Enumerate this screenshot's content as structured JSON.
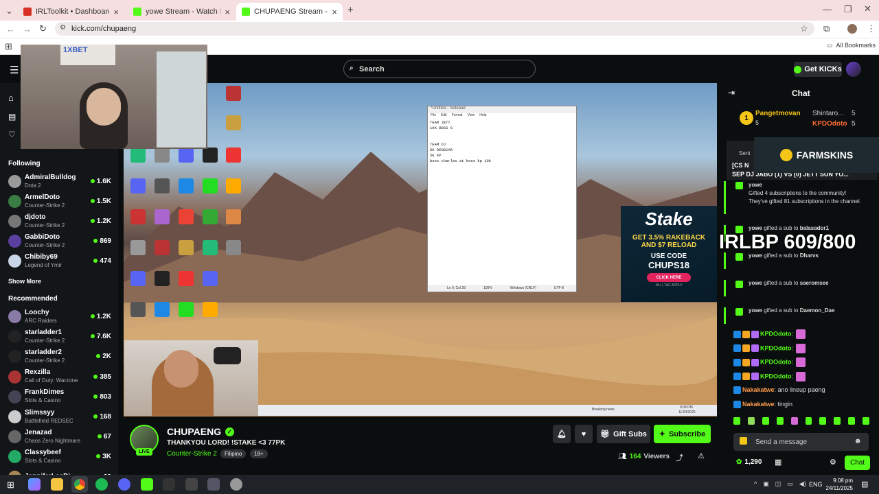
{
  "browser": {
    "tabs": [
      {
        "title": "IRLToolkit • Dashboard",
        "color": "#d93025"
      },
      {
        "title": "yowe Stream - Watch Live on K",
        "color": "#53fc18"
      },
      {
        "title": "CHUPAENG Stream - Watch Liv",
        "color": "#53fc18"
      }
    ],
    "url": "kick.com/chupaeng",
    "all_bookmarks": "All Bookmarks"
  },
  "topnav": {
    "search_placeholder": "Search",
    "get_kicks": "Get KICKs"
  },
  "sidebar": {
    "following_title": "Following",
    "following": [
      {
        "name": "AdmiralBulldog",
        "game": "Dota 2",
        "viewers": "1.6K",
        "color": "#9a9a9a"
      },
      {
        "name": "ArmelDoto",
        "game": "Counter-Strike 2",
        "viewers": "1.5K",
        "color": "#3a7d44"
      },
      {
        "name": "djdoto",
        "game": "Counter-Strike 2",
        "viewers": "1.2K",
        "color": "#777"
      },
      {
        "name": "GabbiDoto",
        "game": "Counter-Strike 2",
        "viewers": "869",
        "color": "#5b3fa0"
      },
      {
        "name": "Chibiby69",
        "game": "Legend of Ymir",
        "viewers": "474",
        "color": "#c9d6e8"
      }
    ],
    "show_more": "Show More",
    "recommended_title": "Recommended",
    "recommended": [
      {
        "name": "Loochy",
        "game": "ARC Raiders",
        "viewers": "1.2K",
        "color": "#8a7aa8"
      },
      {
        "name": "starladder1",
        "game": "Counter-Strike 2",
        "viewers": "7.6K",
        "color": "#222"
      },
      {
        "name": "starladder2",
        "game": "Counter-Strike 2",
        "viewers": "2K",
        "color": "#222"
      },
      {
        "name": "Rexzilla",
        "game": "Call of Duty: Warzone",
        "viewers": "385",
        "color": "#a33"
      },
      {
        "name": "FrankDimes",
        "game": "Slots & Casino",
        "viewers": "803",
        "color": "#445"
      },
      {
        "name": "Slimssyy",
        "game": "Battlefield REDSEC",
        "viewers": "168",
        "color": "#ccc"
      },
      {
        "name": "Jenazad",
        "game": "Chaos Zero Nightmare",
        "viewers": "67",
        "color": "#666"
      },
      {
        "name": "Classybeef",
        "game": "Slots & Casino",
        "viewers": "3K",
        "color": "#2a6"
      },
      {
        "name": "JenniferLeeDi",
        "game": "",
        "viewers": "29",
        "color": "#a85"
      }
    ]
  },
  "video": {
    "notepad": {
      "title": "*Untitled - Notepad",
      "menu": [
        "File",
        "Edit",
        "Format",
        "View",
        "Help"
      ],
      "text": "TEAM JETT\n10K BOSS G\n\n\nTEAM DJ\n5K DENGCAR\n5K KP\nboss charles at boss kp 10k",
      "status": [
        "Ln 9, Col 28",
        "100%",
        "Windows (CRLF)",
        "UTF-8"
      ]
    },
    "stake": {
      "brand": "Stake",
      "line1": "GET 3.5% RAKEBACK",
      "line2": "AND $7 RELOAD",
      "line3": "USE CODE",
      "code": "CHUPS18",
      "cta": "CLICK HERE",
      "fine": "18+ | T&C APPLY"
    },
    "cam_sponsor": "1XBET",
    "stream_time": "9:08 PM",
    "stream_date": "11/24/2025",
    "breaking_news": "Breaking news"
  },
  "stream": {
    "channel": "CHUPAENG",
    "title": "THANKYOU LORD! !STAKE <3 77PK",
    "game": "Counter-Strike 2",
    "tags": [
      "Filipino",
      "18+"
    ],
    "live_label": "LIVE",
    "gift_subs": "Gift Subs",
    "subscribe": "Subscribe",
    "viewers": "164",
    "viewers_label": "Viewers"
  },
  "chat": {
    "title": "Chat",
    "top_gifters": [
      {
        "rank": "1",
        "name": "Pangetmovan",
        "count": "5"
      },
      {
        "name": "Shintaro...",
        "count": "5"
      },
      {
        "name": "KPDOdoto",
        "count": "5"
      }
    ],
    "pinned_label": "Sent",
    "pinned_text": "[CS N",
    "pinned_text2": "SEP DJ JABO (1) VS (0) JETT SUN YO...",
    "farmskins": "FARMSKINS",
    "overlay": "IRLBP 609/800",
    "gift_main": {
      "user": "yowe",
      "text": "Gifted 4 subscriptions to the community!",
      "text2": "They've gifted 81 subscriptions in the channel."
    },
    "gifts": [
      {
        "user": "yowe",
        "action": "gifted a sub to",
        "target": "balasador1"
      },
      {
        "user": "yowe",
        "action": "gifted a sub to",
        "target": "Dharvs"
      },
      {
        "user": "yowe",
        "action": "gifted a sub to",
        "target": "saeromsee"
      },
      {
        "user": "yowe",
        "action": "gifted a sub to",
        "target": "Daemon_Dae"
      }
    ],
    "messages": [
      {
        "user": "KPDOdoto",
        "text": ":"
      },
      {
        "user": "KPDOdoto",
        "text": ":"
      },
      {
        "user": "KPDOdoto",
        "text": ":"
      },
      {
        "user": "KPDOdoto",
        "text": ":"
      },
      {
        "user": "Nakakatwe",
        "text": ": ano lineup paeng"
      },
      {
        "user": "Nakakatwe",
        "text": ": tingin"
      }
    ],
    "send_placeholder": "Send a message",
    "points": "1,290",
    "chat_button": "Chat"
  },
  "windows": {
    "lang": "ENG",
    "time": "9:08 pm",
    "date": "24/11/2025"
  },
  "colors": {
    "kick_green": "#53fc18",
    "bg": "#0b0e0f",
    "sidebar": "#131618"
  }
}
